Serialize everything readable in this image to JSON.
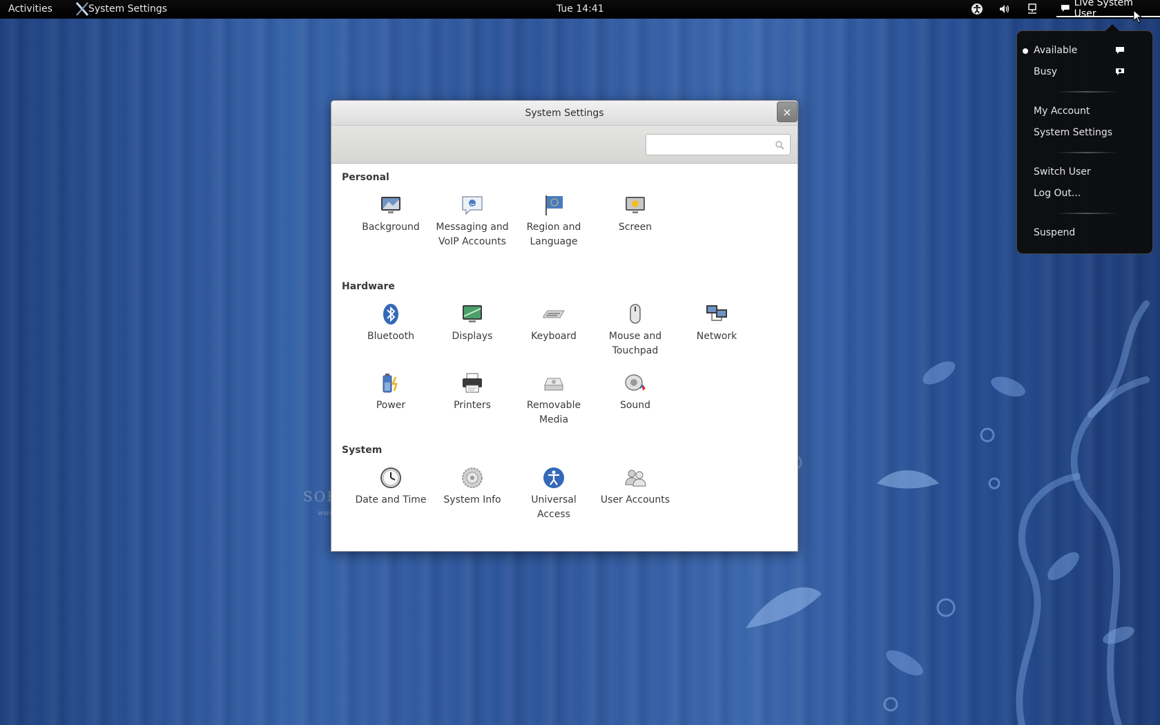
{
  "topbar": {
    "activities": "Activities",
    "app_name": "System Settings",
    "clock": "Tue 14:41",
    "user_name": "Live System User",
    "icons": [
      "accessibility-icon",
      "volume-icon",
      "network-icon",
      "chat-bubble-icon"
    ]
  },
  "user_menu": {
    "items": [
      {
        "label": "Available",
        "icon": "chat-bubble-icon",
        "selected": true
      },
      {
        "label": "Busy",
        "icon": "chat-busy-icon",
        "selected": false
      },
      {
        "label": "My Account"
      },
      {
        "label": "System Settings"
      },
      {
        "label": "Switch User"
      },
      {
        "label": "Log Out..."
      },
      {
        "label": "Suspend"
      }
    ]
  },
  "window": {
    "title": "System Settings",
    "close_label": "×",
    "search_placeholder": "",
    "sections": [
      {
        "title": "Personal",
        "items": [
          {
            "label": "Background",
            "icon": "background-icon"
          },
          {
            "label": "Messaging and VoIP Accounts",
            "icon": "messaging-icon"
          },
          {
            "label": "Region and Language",
            "icon": "region-flag-icon"
          },
          {
            "label": "Screen",
            "icon": "screen-icon"
          }
        ]
      },
      {
        "title": "Hardware",
        "items": [
          {
            "label": "Bluetooth",
            "icon": "bluetooth-icon"
          },
          {
            "label": "Displays",
            "icon": "displays-icon"
          },
          {
            "label": "Keyboard",
            "icon": "keyboard-icon"
          },
          {
            "label": "Mouse and Touchpad",
            "icon": "mouse-icon"
          },
          {
            "label": "Network",
            "icon": "network-icon"
          },
          {
            "label": "Power",
            "icon": "power-icon"
          },
          {
            "label": "Printers",
            "icon": "printer-icon"
          },
          {
            "label": "Removable Media",
            "icon": "removable-media-icon"
          },
          {
            "label": "Sound",
            "icon": "sound-icon"
          }
        ]
      },
      {
        "title": "System",
        "items": [
          {
            "label": "Date and Time",
            "icon": "clock-icon"
          },
          {
            "label": "System Info",
            "icon": "system-info-icon"
          },
          {
            "label": "Universal Access",
            "icon": "universal-access-icon"
          },
          {
            "label": "User Accounts",
            "icon": "user-accounts-icon"
          }
        ]
      }
    ]
  },
  "watermark": {
    "text": "SOFTPEDIA",
    "url": "www.softpedia.com"
  },
  "colors": {
    "desktop": "#2c5499",
    "topbar": "#000000",
    "accent": "#3465a4"
  }
}
